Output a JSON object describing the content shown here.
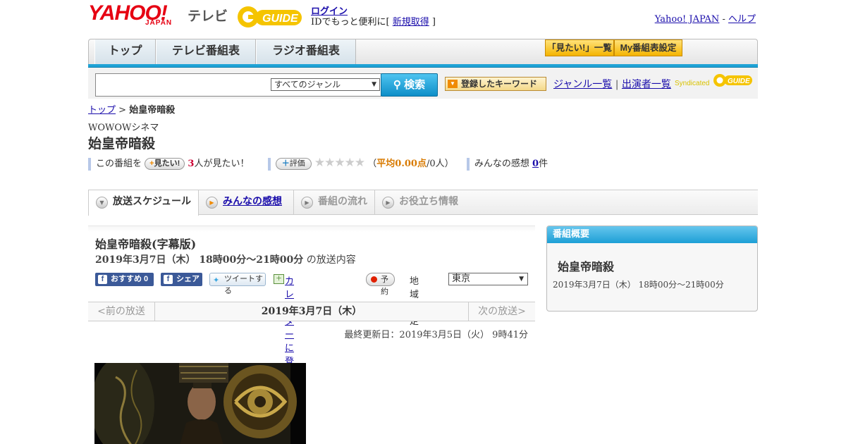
{
  "header": {
    "logo_text": "YAHOO!",
    "logo_sub": "JAPAN",
    "tv_label": "テレビ",
    "guide_logo_text": "GUIDE",
    "login_link": "ログイン",
    "login_sub_prefix": "IDでもっと便利に[ ",
    "signup_link": "新規取得",
    "login_sub_suffix": " ]",
    "yahoo_japan_link": "Yahoo! JAPAN",
    "dash": " - ",
    "help_link": "ヘルプ"
  },
  "nav": {
    "tabs": [
      "トップ",
      "テレビ番組表",
      "ラジオ番組表"
    ],
    "mitai_list": "「見たい!」一覧",
    "my_bangumi": "My番組表設定"
  },
  "search": {
    "genre_selected": "すべてのジャンル",
    "search_button": "検索",
    "keyword_button": "登録したキーワード",
    "genre_list_link": "ジャンル一覧",
    "performers_link": "出演者一覧",
    "separator": "|",
    "syndicated": "Syndicated"
  },
  "breadcrumb": {
    "top": "トップ",
    "sep": " > ",
    "current": "始皇帝暗殺"
  },
  "program": {
    "channel": "WOWOWシネマ",
    "title": "始皇帝暗殺",
    "mitai_prefix": "この番組を",
    "mitai_button": "見たい!",
    "mitai_count": "3",
    "mitai_suffix": "人が見たい！",
    "rating_button": "評価",
    "rating_stars_filled": 0,
    "rating_text_open": "（",
    "rating_avg": "平均0.00点",
    "rating_count": "/0人）",
    "kansou_label": "みんなの感想 ",
    "kansou_count": "0",
    "kansou_unit": "件"
  },
  "tabs": {
    "schedule": "放送スケジュール",
    "reviews": "みんなの感想",
    "flow": "番組の流れ",
    "info": "お役立ち情報"
  },
  "broadcast": {
    "title": "始皇帝暗殺(字幕版)",
    "time": "2019年3月7日（木） 18時00分～21時00分",
    "time_suffix": " の放送内容",
    "fb_recommend": "おすすめ 0",
    "fb_share": "シェア",
    "tweet": "ツイートする",
    "calendar": "カレンダーに登録",
    "reserve": "予約",
    "region_label": "地域設定",
    "region_value": "東京"
  },
  "pager": {
    "prev": "<前の放送",
    "current": "2019年3月7日（木）",
    "next": "次の放送>"
  },
  "updated": "最終更新日：2019年3月5日（火） 9時41分",
  "side": {
    "head": "番組概要",
    "title": "始皇帝暗殺",
    "time": "2019年3月7日（木） 18時00分～21時00分"
  },
  "colors": {
    "accent_blue": "#1fa3d6",
    "yahoo_red": "#e60012",
    "facebook": "#3b5998"
  }
}
